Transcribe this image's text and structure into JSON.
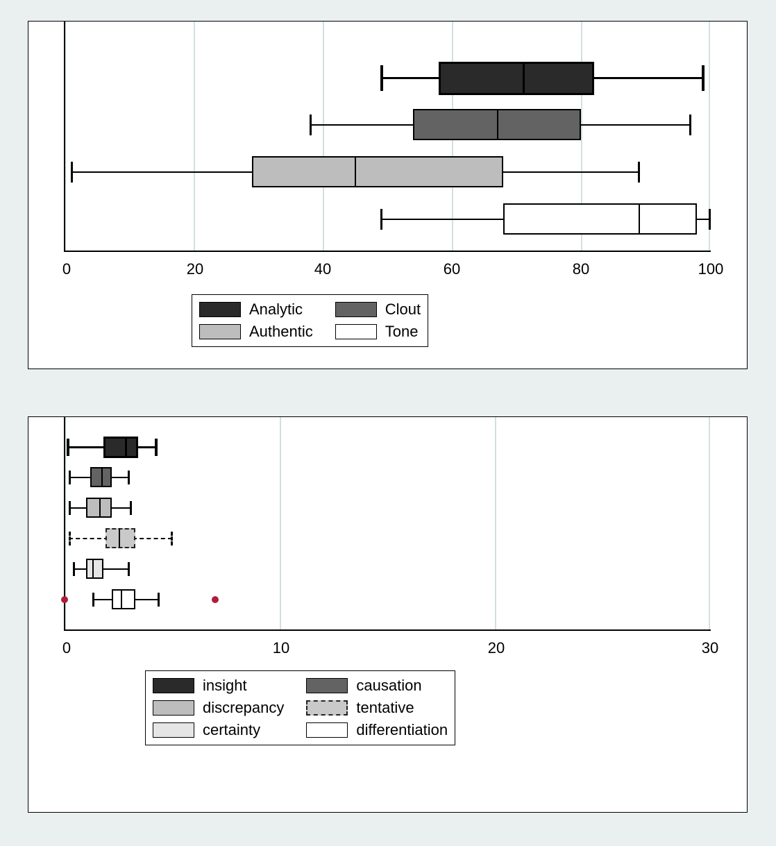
{
  "chart_data": [
    {
      "type": "boxplot",
      "orientation": "horizontal",
      "xlim": [
        0,
        100
      ],
      "xticks": [
        0,
        20,
        40,
        60,
        80,
        100
      ],
      "series": [
        {
          "name": "Analytic",
          "min": 49,
          "q1": 58,
          "median": 71,
          "q3": 82,
          "max": 99,
          "fill": "darkest",
          "thick": true
        },
        {
          "name": "Clout",
          "min": 38,
          "q1": 54,
          "median": 67,
          "q3": 80,
          "max": 97,
          "fill": "dark"
        },
        {
          "name": "Authentic",
          "min": 1,
          "q1": 29,
          "median": 45,
          "q3": 68,
          "max": 89,
          "fill": "light"
        },
        {
          "name": "Tone",
          "min": 49,
          "q1": 68,
          "median": 89,
          "q3": 98,
          "max": 100,
          "fill": "white"
        }
      ]
    },
    {
      "type": "boxplot",
      "orientation": "horizontal",
      "xlim": [
        0,
        30
      ],
      "xticks": [
        0,
        10,
        20,
        30
      ],
      "series": [
        {
          "name": "insight",
          "min": 0.1,
          "q1": 1.8,
          "median": 2.8,
          "q3": 3.4,
          "max": 4.3,
          "fill": "darkest",
          "thick": true
        },
        {
          "name": "causation",
          "min": 0.2,
          "q1": 1.2,
          "median": 1.7,
          "q3": 2.2,
          "max": 3.0,
          "fill": "dark"
        },
        {
          "name": "discrepancy",
          "min": 0.2,
          "q1": 1.0,
          "median": 1.6,
          "q3": 2.2,
          "max": 3.1,
          "fill": "light"
        },
        {
          "name": "tentative",
          "min": 0.2,
          "q1": 1.9,
          "median": 2.5,
          "q3": 3.3,
          "max": 5.0,
          "fill": "dashed",
          "dashed": true
        },
        {
          "name": "certainty",
          "min": 0.4,
          "q1": 1.0,
          "median": 1.3,
          "q3": 1.8,
          "max": 3.0,
          "fill": "faint"
        },
        {
          "name": "differentiation",
          "min": 1.3,
          "q1": 2.2,
          "median": 2.6,
          "q3": 3.3,
          "max": 4.4,
          "fill": "white",
          "outliers": [
            0.0,
            7.0
          ]
        }
      ]
    }
  ]
}
